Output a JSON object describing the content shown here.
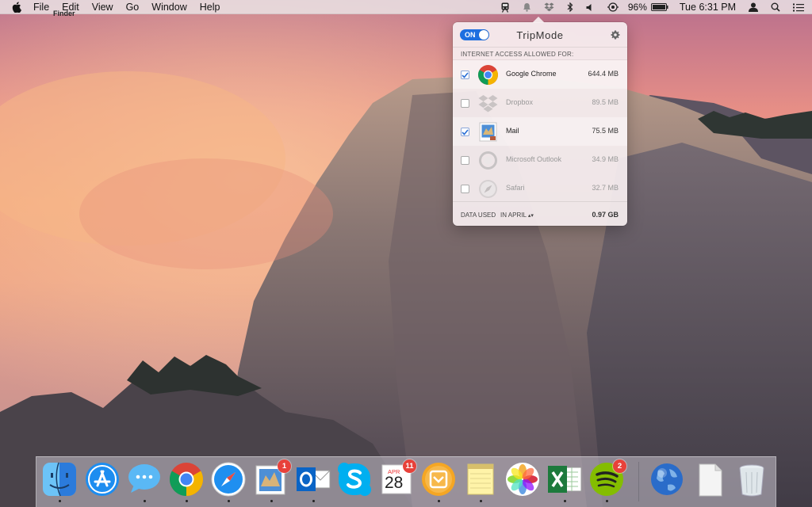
{
  "menubar": {
    "app_name": "Finder",
    "menus": [
      "File",
      "Edit",
      "View",
      "Go",
      "Window",
      "Help"
    ],
    "battery_text": "96%",
    "clock": "Tue 6:31 PM"
  },
  "tripmode": {
    "title": "TripMode",
    "toggle_label": "ON",
    "section_label": "INTERNET ACCESS ALLOWED FOR:",
    "apps": [
      {
        "name": "Google Chrome",
        "size": "644.4 MB",
        "allowed": true
      },
      {
        "name": "Dropbox",
        "size": "89.5 MB",
        "allowed": false
      },
      {
        "name": "Mail",
        "size": "75.5 MB",
        "allowed": true
      },
      {
        "name": "Microsoft Outlook",
        "size": "34.9 MB",
        "allowed": false
      },
      {
        "name": "Safari",
        "size": "32.7 MB",
        "allowed": false
      }
    ],
    "footer": {
      "used_label": "DATA USED",
      "period": "IN APRIL",
      "total": "0.97 GB"
    }
  },
  "dock": {
    "calendar_month": "APR",
    "calendar_day": "28",
    "badges": {
      "mail": "1",
      "calendar": "11",
      "spotify": "2"
    },
    "items": [
      "finder-icon",
      "app-store-icon",
      "messages-icon",
      "chrome-icon",
      "safari-icon",
      "mail-icon",
      "outlook-icon",
      "skype-icon",
      "calendar-icon",
      "tripmode-icon",
      "notes-icon",
      "photos-icon",
      "excel-icon",
      "spotify-icon",
      "globe-icon",
      "document-icon",
      "trash-icon"
    ]
  }
}
